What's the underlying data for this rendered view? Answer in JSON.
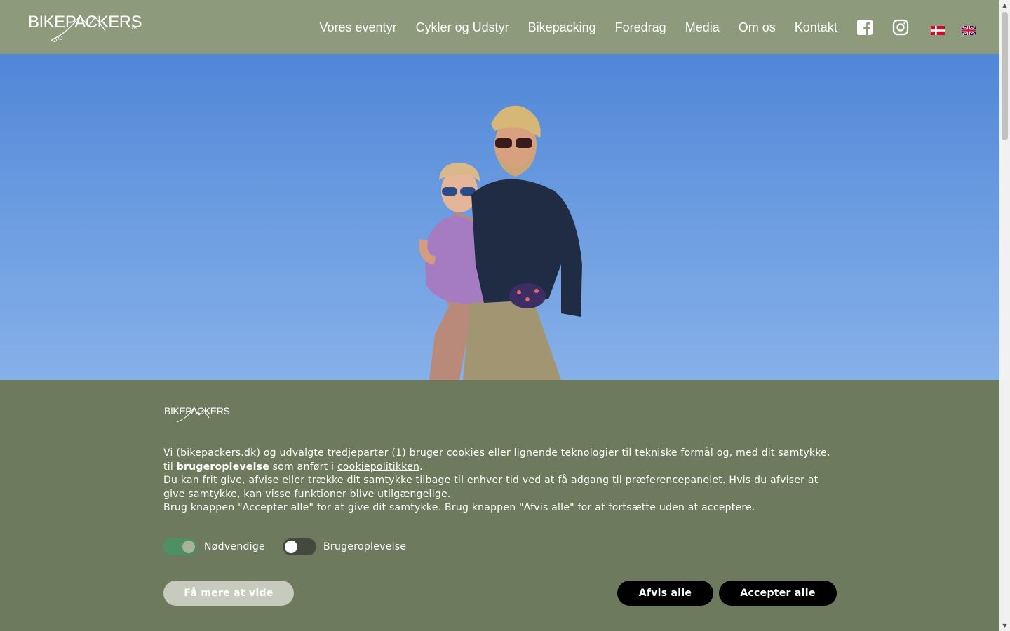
{
  "header": {
    "logo_text": "BIKEPACKERS",
    "logo_sub": ".DK",
    "nav": [
      "Vores eventyr",
      "Cykler og Udstyr",
      "Bikepacking",
      "Foredrag",
      "Media",
      "Om os",
      "Kontakt"
    ],
    "icons": [
      "facebook-icon",
      "instagram-icon"
    ],
    "languages": [
      "danish-flag",
      "english-flag"
    ]
  },
  "hero": {
    "image": "couple-in-front-of-blue-sky"
  },
  "cookie": {
    "logo_text": "BIKEPACKERS",
    "p1_a": "Vi (bikepackers.dk) og udvalgte tredjeparter (1) bruger cookies eller lignende teknologier til tekniske formål og, med dit samtykke, til ",
    "p1_bold": "brugeroplevelse",
    "p1_b": " som anført i ",
    "p1_link": "cookiepolitikken",
    "p1_c": ".",
    "p2": "Du kan frit give, afvise eller trække dit samtykke tilbage til enhver tid ved at få adgang til præferencepanelet. Hvis du afviser at give samtykke, kan visse funktioner blive utilgængelige.",
    "p3": "Brug knappen \"Accepter alle\" for at give dit samtykke. Brug knappen \"Afvis alle\" for at fortsætte uden at acceptere.",
    "toggles": [
      {
        "label": "Nødvendige",
        "state": "on"
      },
      {
        "label": "Brugeroplevelse",
        "state": "off"
      }
    ],
    "btn_more": "Få mere at vide",
    "btn_reject": "Afvis alle",
    "btn_accept": "Accepter alle"
  },
  "colors": {
    "header_bg": "#8e9a7c",
    "banner_bg": "#6e7a5e",
    "toggle_on": "#4e8f63",
    "button_dark": "#000000"
  }
}
